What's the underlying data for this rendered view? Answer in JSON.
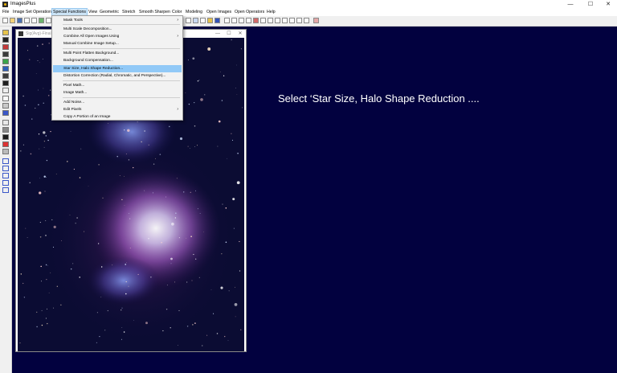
{
  "window": {
    "title": "ImagesPlus",
    "minimize": "—",
    "maximize": "☐",
    "close": "✕"
  },
  "menu": [
    "File",
    "Image Set Operations",
    "Special Functions",
    "View",
    "Geometric",
    "Stretch",
    "Smooth Sharpen",
    "Color",
    "Modeling",
    "Open Images",
    "Open Operators",
    "Help"
  ],
  "active_menu": "Special Functions",
  "dropdown": {
    "items": [
      {
        "label": "Mask Tools",
        "submenu": true
      },
      {
        "label": "Multi Scale Decomposition...",
        "submenu": false
      },
      {
        "label": "Combine All Open Images Using",
        "submenu": true
      },
      {
        "label": "Manual Combine Image Setup...",
        "submenu": false
      },
      {
        "label": "Multi Point Flatten Background...",
        "submenu": false
      },
      {
        "label": "Background Compensation...",
        "submenu": false
      },
      {
        "label": "Star Size, Halo Shape Reduction...",
        "submenu": false,
        "highlighted": true
      },
      {
        "label": "Distortion Correction (Radial, Chromatic, and Perspective)...",
        "submenu": false
      },
      {
        "label": "Pixel Math...",
        "submenu": false
      },
      {
        "label": "Image Math...",
        "submenu": false
      },
      {
        "label": "Add Noise...",
        "submenu": false
      },
      {
        "label": "Edit Pixels",
        "submenu": true
      },
      {
        "label": "Copy A Portion of an Image",
        "submenu": false
      }
    ],
    "submenu_arrow": "›"
  },
  "image_window": {
    "title": "Sig(Avg)-Final",
    "minimize": "—",
    "maximize": "☐",
    "close": "✕"
  },
  "caption": "Select ‘Star Size, Halo Shape Reduction ....",
  "colors": {
    "workspace_bg": "#02013f",
    "menu_highlight": "#91c9f7",
    "caption_text": "#ffffff"
  },
  "icons": {
    "app": "imagesplus-app-icon",
    "toolbar": [
      "new-file-icon",
      "open-folder-icon",
      "save-icon",
      "print-icon",
      "copy-icon",
      "paste-icon",
      "undo-icon",
      "zoom-in-icon",
      "zoom-out-icon",
      "zoom-fit-icon",
      "grid-icon",
      "histogram-icon",
      "crop-icon",
      "rotate-icon"
    ],
    "left": [
      "select-icon",
      "move-icon",
      "color-swatch-icon",
      "crop-tool-icon",
      "brush-icon",
      "eraser-icon",
      "eyedropper-icon",
      "text-tool-icon",
      "arrow-icon",
      "measure-icon"
    ]
  }
}
